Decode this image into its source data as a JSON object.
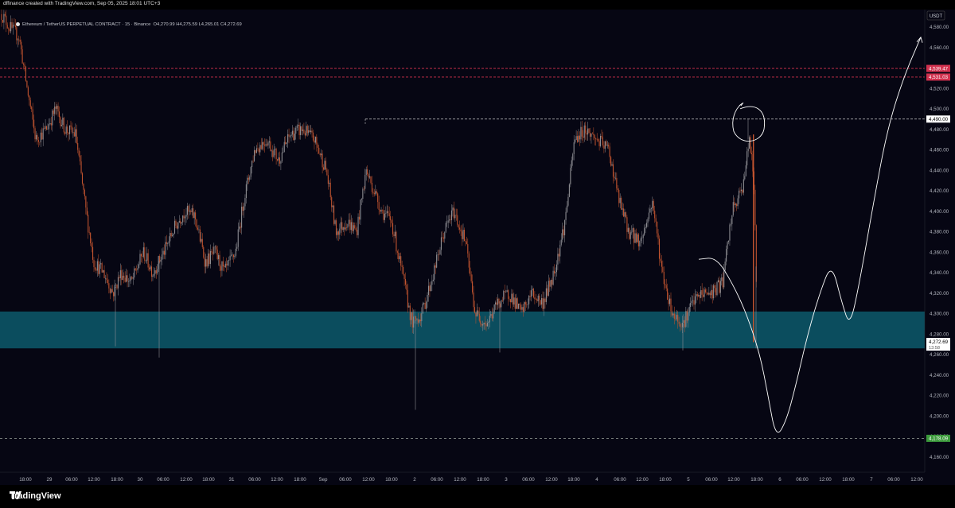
{
  "header": {
    "credit": "dffinance created with TradingView.com, Sep 05, 2025 18:01 UTC+3",
    "symbol": "Ethereum / TetherUS PERPETUAL CONTRACT · 15 · Binance",
    "ohlc": "O4,270.99 H4,275.59 L4,265.01 C4,272.69",
    "currency": "USDT"
  },
  "footer": {
    "brand": "TradingView"
  },
  "colors": {
    "background": "#060613",
    "candle_up": "#8e8e93",
    "candle_down": "#c2542f",
    "zone": "#0b4d5e",
    "resistance_line": "#d1314e",
    "support_label": "#3c9a3c",
    "drawing": "#ffffff"
  },
  "chart_data": {
    "type": "candlestick",
    "ylim": [
      4145,
      4597
    ],
    "y_ticks": [
      "4,580.00",
      "4,560.00",
      "4,540.00",
      "4,520.00",
      "4,500.00",
      "4,480.00",
      "4,460.00",
      "4,440.00",
      "4,420.00",
      "4,400.00",
      "4,380.00",
      "4,360.00",
      "4,340.00",
      "4,320.00",
      "4,300.00",
      "4,280.00",
      "4,260.00",
      "4,240.00",
      "4,220.00",
      "4,200.00",
      "4,180.00",
      "4,160.00"
    ],
    "x_ticks": [
      "18:00",
      "29",
      "06:00",
      "12:00",
      "18:00",
      "30",
      "06:00",
      "12:00",
      "18:00",
      "31",
      "06:00",
      "12:00",
      "18:00",
      "Sep",
      "06:00",
      "12:00",
      "18:00",
      "2",
      "06:00",
      "12:00",
      "18:00",
      "3",
      "06:00",
      "12:00",
      "18:00",
      "4",
      "06:00",
      "12:00",
      "18:00",
      "5",
      "06:00",
      "12:00",
      "18:00",
      "6",
      "06:00",
      "12:00",
      "18:00",
      "7",
      "06:00",
      "12:00"
    ],
    "price_path": [
      [
        0,
        4595
      ],
      [
        12,
        4580
      ],
      [
        24,
        4570
      ],
      [
        34,
        4520
      ],
      [
        45,
        4470
      ],
      [
        58,
        4480
      ],
      [
        70,
        4500
      ],
      [
        82,
        4480
      ],
      [
        95,
        4475
      ],
      [
        108,
        4400
      ],
      [
        118,
        4350
      ],
      [
        130,
        4340
      ],
      [
        142,
        4320
      ],
      [
        152,
        4340
      ],
      [
        165,
        4330
      ],
      [
        180,
        4360
      ],
      [
        192,
        4340
      ],
      [
        206,
        4360
      ],
      [
        220,
        4385
      ],
      [
        232,
        4400
      ],
      [
        245,
        4395
      ],
      [
        258,
        4350
      ],
      [
        270,
        4360
      ],
      [
        282,
        4340
      ],
      [
        296,
        4360
      ],
      [
        306,
        4410
      ],
      [
        320,
        4460
      ],
      [
        335,
        4470
      ],
      [
        350,
        4450
      ],
      [
        365,
        4475
      ],
      [
        380,
        4480
      ],
      [
        395,
        4470
      ],
      [
        410,
        4440
      ],
      [
        422,
        4380
      ],
      [
        436,
        4390
      ],
      [
        448,
        4380
      ],
      [
        460,
        4440
      ],
      [
        470,
        4420
      ],
      [
        480,
        4400
      ],
      [
        492,
        4390
      ],
      [
        505,
        4340
      ],
      [
        518,
        4290
      ],
      [
        530,
        4300
      ],
      [
        545,
        4340
      ],
      [
        558,
        4380
      ],
      [
        570,
        4400
      ],
      [
        585,
        4370
      ],
      [
        597,
        4300
      ],
      [
        612,
        4290
      ],
      [
        625,
        4310
      ],
      [
        640,
        4320
      ],
      [
        655,
        4300
      ],
      [
        668,
        4320
      ],
      [
        682,
        4310
      ],
      [
        696,
        4340
      ],
      [
        710,
        4390
      ],
      [
        722,
        4470
      ],
      [
        735,
        4480
      ],
      [
        750,
        4470
      ],
      [
        765,
        4460
      ],
      [
        778,
        4410
      ],
      [
        790,
        4380
      ],
      [
        805,
        4370
      ],
      [
        820,
        4410
      ],
      [
        832,
        4340
      ],
      [
        845,
        4300
      ],
      [
        858,
        4290
      ],
      [
        870,
        4310
      ],
      [
        882,
        4320
      ],
      [
        894,
        4320
      ],
      [
        908,
        4330
      ],
      [
        920,
        4400
      ],
      [
        932,
        4420
      ],
      [
        942,
        4470
      ],
      [
        948,
        4420
      ],
      [
        952,
        4272
      ]
    ],
    "zone": {
      "y0": 4266,
      "y1": 4302
    },
    "resistance_1": 4539.47,
    "resistance_2": 4531.03,
    "high_level": 4490.0,
    "support_level": 4178.09,
    "current_price": 4272.69,
    "countdown": "13:58",
    "price_labels": [
      "4,539.47",
      "4,531.03",
      "4,490.00",
      "4,272.69",
      "4,178.09"
    ],
    "projection": [
      [
        878,
        4353
      ],
      [
        900,
        4355
      ],
      [
        920,
        4330
      ],
      [
        938,
        4300
      ],
      [
        955,
        4260
      ],
      [
        965,
        4220
      ],
      [
        975,
        4178
      ],
      [
        988,
        4195
      ],
      [
        1000,
        4230
      ],
      [
        1015,
        4280
      ],
      [
        1030,
        4320
      ],
      [
        1045,
        4350
      ],
      [
        1058,
        4310
      ],
      [
        1068,
        4287
      ],
      [
        1080,
        4330
      ],
      [
        1098,
        4410
      ],
      [
        1115,
        4480
      ],
      [
        1135,
        4530
      ],
      [
        1157,
        4570
      ]
    ]
  }
}
